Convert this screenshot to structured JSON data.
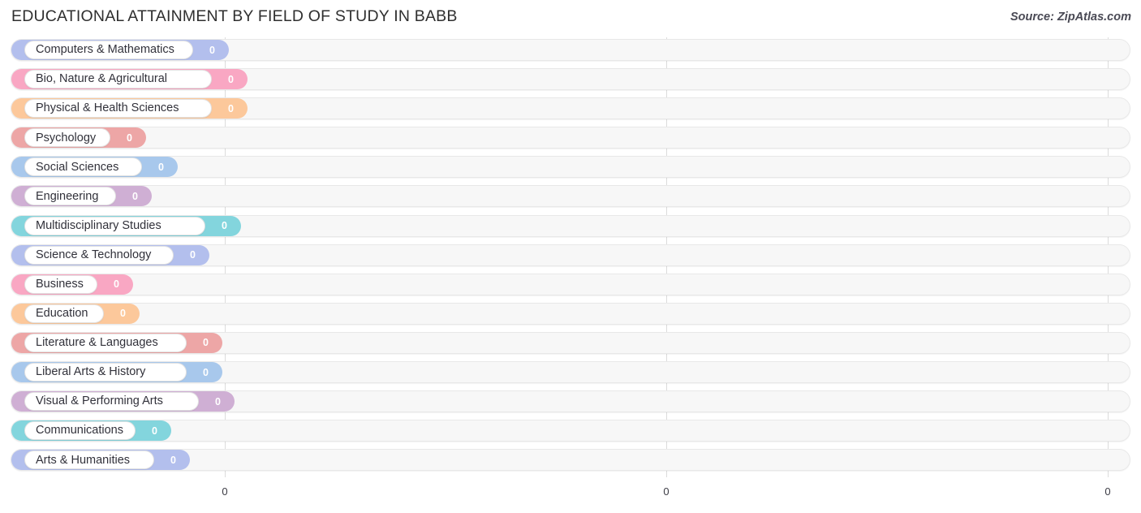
{
  "header": {
    "title": "EDUCATIONAL ATTAINMENT BY FIELD OF STUDY IN BABB",
    "source": "Source: ZipAtlas.com"
  },
  "chart_data": {
    "type": "bar",
    "orientation": "horizontal",
    "title": "EDUCATIONAL ATTAINMENT BY FIELD OF STUDY IN BABB",
    "xlabel": "",
    "ylabel": "",
    "grid": true,
    "legend": false,
    "xlim": [
      0,
      0
    ],
    "xticks": [
      "0",
      "0",
      "0"
    ],
    "categories": [
      "Computers & Mathematics",
      "Bio, Nature & Agricultural",
      "Physical & Health Sciences",
      "Psychology",
      "Social Sciences",
      "Engineering",
      "Multidisciplinary Studies",
      "Science & Technology",
      "Business",
      "Education",
      "Literature & Languages",
      "Liberal Arts & History",
      "Visual & Performing Arts",
      "Communications",
      "Arts & Humanities"
    ],
    "values": [
      0,
      0,
      0,
      0,
      0,
      0,
      0,
      0,
      0,
      0,
      0,
      0,
      0,
      0,
      0
    ],
    "value_labels": [
      "0",
      "0",
      "0",
      "0",
      "0",
      "0",
      "0",
      "0",
      "0",
      "0",
      "0",
      "0",
      "0",
      "0",
      "0"
    ],
    "colors": [
      "#b3bfed",
      "#f9a7c3",
      "#fcc89b",
      "#eda6a6",
      "#a8c8ec",
      "#cfafd4",
      "#83d5dd",
      "#b3bfed",
      "#f9a7c3",
      "#fcc89b",
      "#eda6a6",
      "#a8c8ec",
      "#cfafd4",
      "#83d5dd",
      "#b3bfed"
    ]
  }
}
